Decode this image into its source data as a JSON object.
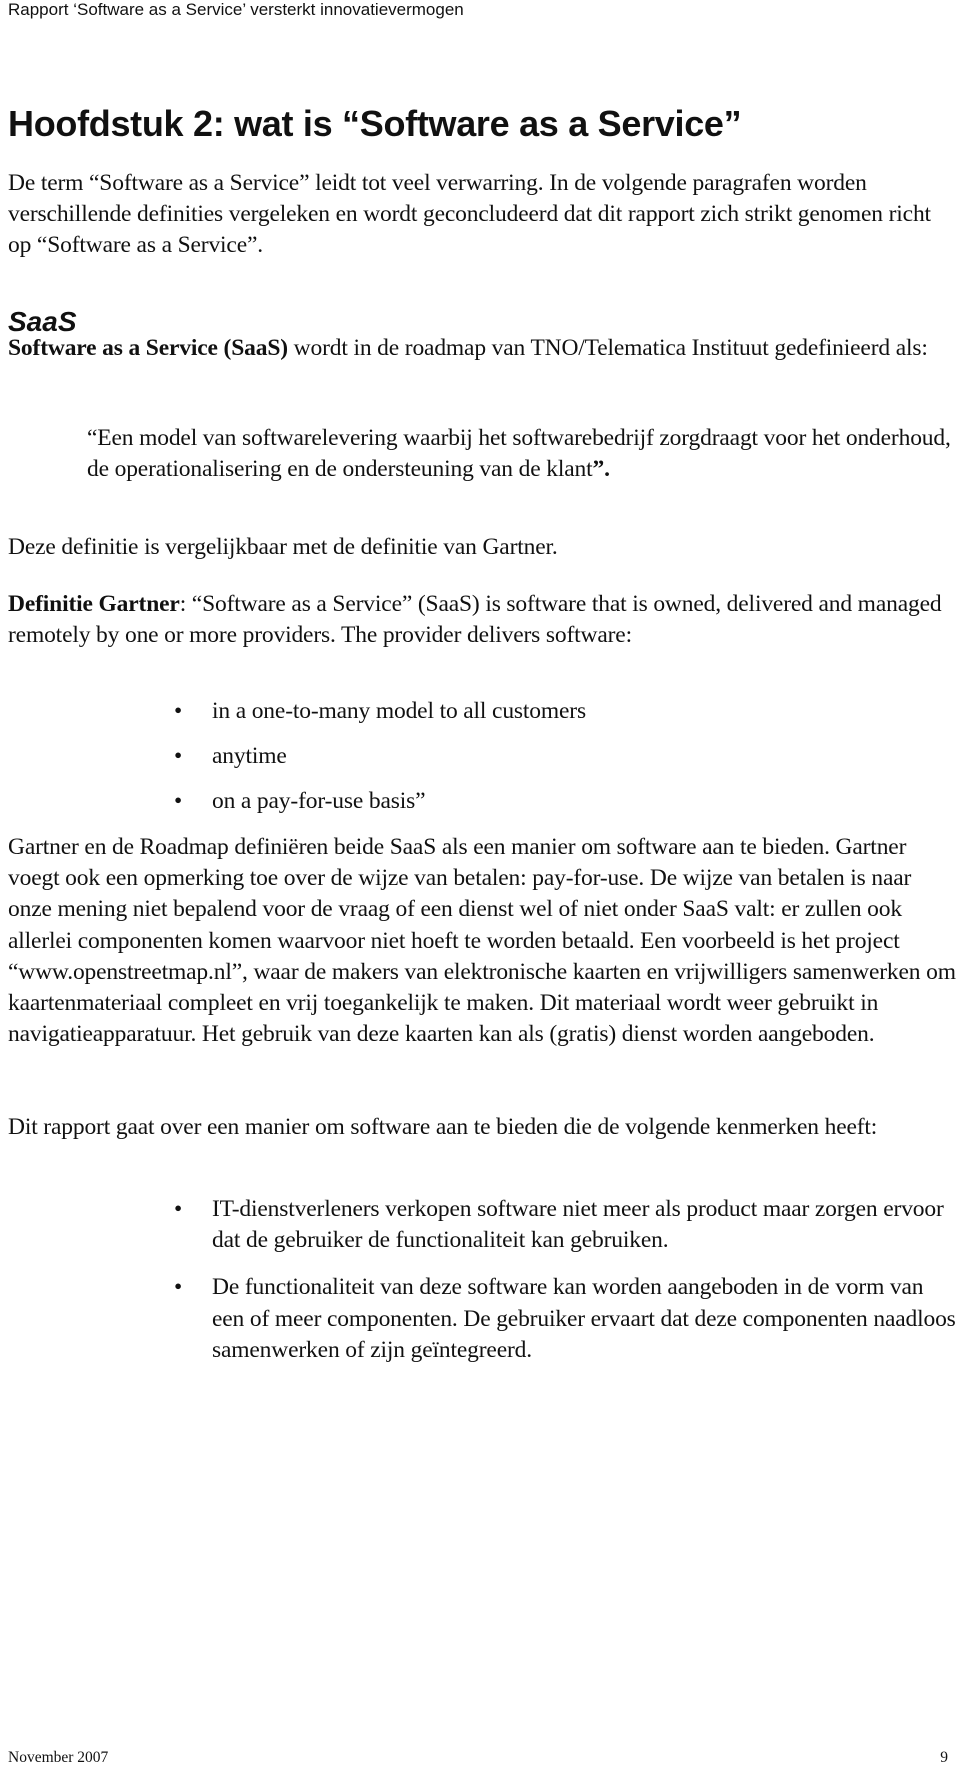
{
  "header": {
    "running_title": "Rapport ‘Software as a Service’ versterkt innovatievermogen"
  },
  "chapter": {
    "title": "Hoofdstuk 2: wat is “Software as a Service”"
  },
  "intro": {
    "text": "De term “Software as a Service” leidt tot veel verwarring. In de volgende paragrafen worden verschillende definities vergeleken en wordt geconcludeerd dat dit rapport zich strikt genomen richt op “Software as a Service”."
  },
  "section": {
    "heading": "SaaS",
    "roadmap_def": {
      "bold": "Software as a Service (SaaS)",
      "rest": " wordt in de roadmap van TNO/Telematica Instituut gedefinieerd als:"
    },
    "quote": {
      "text": "“Een model van softwarelevering waarbij het softwarebedrijf zorgdraagt voor het onderhoud, de operationalisering en de ondersteuning van de klant",
      "closing": "”."
    },
    "comparison": "Deze definitie is vergelijkbaar met de definitie van Gartner.",
    "gartner": {
      "bold": "Definitie Gartner",
      "rest": ": “Software as a Service” (SaaS) is software that is owned, delivered and managed remotely by one or more providers. The provider delivers software:"
    },
    "gartner_bullets": [
      "in a one-to-many model to all customers",
      "anytime",
      "on a pay-for-use basis”"
    ],
    "discussion": "Gartner en de Roadmap definiëren beide SaaS als een manier om software aan te bieden. Gartner voegt ook een opmerking toe over de wijze van betalen: pay-for-use. De wijze van betalen is naar onze mening niet bepalend voor de vraag of een dienst wel of niet onder SaaS valt: er zullen ook allerlei componenten komen waarvoor niet hoeft te worden betaald. Een voorbeeld is het project “www.openstreetmap.nl”, waar de makers van elektronische kaarten en vrijwilligers samenwerken om kaartenmateriaal compleet en vrij toegankelijk te maken. Dit materiaal wordt weer gebruikt in navigatieapparatuur. Het gebruik van deze kaarten kan als (gratis) dienst worden aangeboden.",
    "scope_intro": "Dit rapport gaat over een manier om software aan te bieden die de volgende kenmerken heeft:",
    "scope_bullets": [
      "IT-dienstverleners verkopen software niet meer als product maar zorgen ervoor dat de gebruiker de functionaliteit kan gebruiken.",
      "De functionaliteit van deze software kan worden aangeboden in de vorm van een of meer componenten. De gebruiker ervaart dat deze componenten naadloos samenwerken of zijn geïntegreerd."
    ],
    "bullet_glyph": "•"
  },
  "footer": {
    "date": "November 2007",
    "page_number": "9"
  }
}
